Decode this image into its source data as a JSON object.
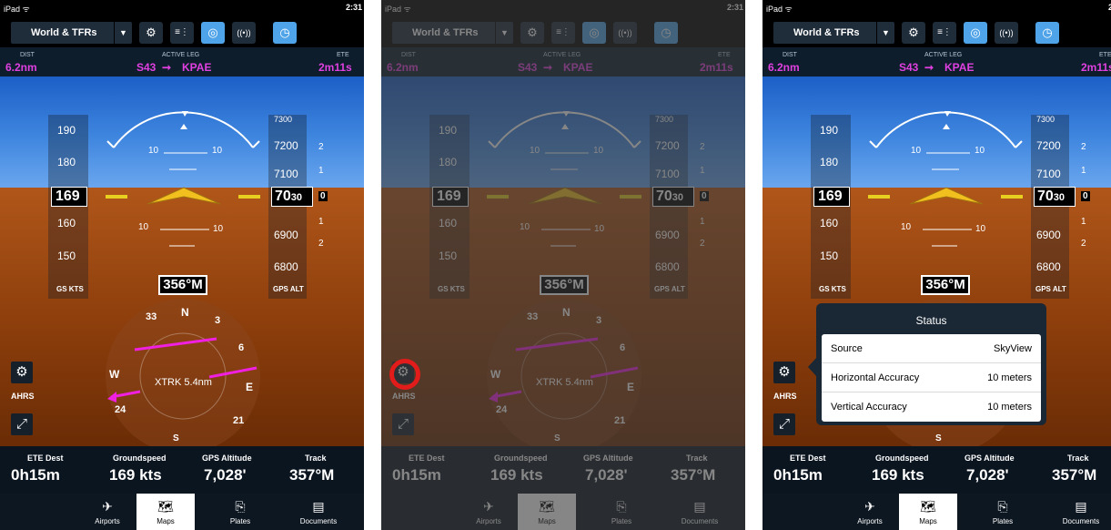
{
  "status_bar": {
    "device": "iPad ᯤ",
    "time": "2:31"
  },
  "toolbar": {
    "layer": "World & TFRs",
    "dropdown": "▼",
    "settings_icon": "⚙",
    "list_icon": "≡⋮",
    "globe_icon": "◎",
    "signal_icon": "((•))",
    "clock_icon": "◷"
  },
  "leg": {
    "dist_caption": "DIST",
    "dist_value": "6.2nm",
    "active_caption": "ACTIVE LEG",
    "from": "S43",
    "arrow": "➞",
    "to": "KPAE",
    "ete_caption": "ETE",
    "ete_value": "2m11s"
  },
  "speed_tape": {
    "ticks": [
      "190",
      "180",
      "160",
      "150"
    ],
    "current": "169",
    "label": "GS KTS"
  },
  "altitude_tape": {
    "ticks": [
      "7200",
      "7100",
      "6900",
      "6800"
    ],
    "top_partial": "7300",
    "current_big": "70",
    "current_small": "30",
    "label": "GPS ALT"
  },
  "vsi": {
    "up": [
      "2",
      "1"
    ],
    "zero": "0",
    "down": [
      "1",
      "2"
    ]
  },
  "pitch": {
    "left_up": "10",
    "right_up": "10",
    "left_down": "10",
    "right_down": "10"
  },
  "heading": {
    "value": "356°M",
    "cards": [
      "N",
      "3",
      "33",
      "6",
      "E",
      "W",
      "24",
      "21",
      "S"
    ],
    "xtrk": "XTRK 5.4nm"
  },
  "controls": {
    "ahrs_label": "AHRS",
    "gear_icon": "⚙",
    "expand_icon": "⤢"
  },
  "databar": {
    "items": [
      {
        "caption": "ETE Dest",
        "value": "0h15m"
      },
      {
        "caption": "Groundspeed",
        "value": "169 kts"
      },
      {
        "caption": "GPS Altitude",
        "value": "7,028'"
      },
      {
        "caption": "Track",
        "value": "357°M"
      }
    ]
  },
  "tabs": [
    {
      "icon": "✈",
      "label": "Airports"
    },
    {
      "icon": "🗺",
      "label": "Maps"
    },
    {
      "icon": "⎘",
      "label": "Plates"
    },
    {
      "icon": "▤",
      "label": "Documents"
    }
  ],
  "popover": {
    "title": "Status",
    "rows": [
      {
        "key": "Source",
        "value": "SkyView"
      },
      {
        "key": "Horizontal Accuracy",
        "value": "10 meters"
      },
      {
        "key": "Vertical Accuracy",
        "value": "10 meters"
      }
    ]
  },
  "colors": {
    "magenta": "#e040e0",
    "active_blue": "#4fa3e8",
    "sky": "#3f86df",
    "ground": "#8b3d0b",
    "ring": "#e21b1b"
  }
}
